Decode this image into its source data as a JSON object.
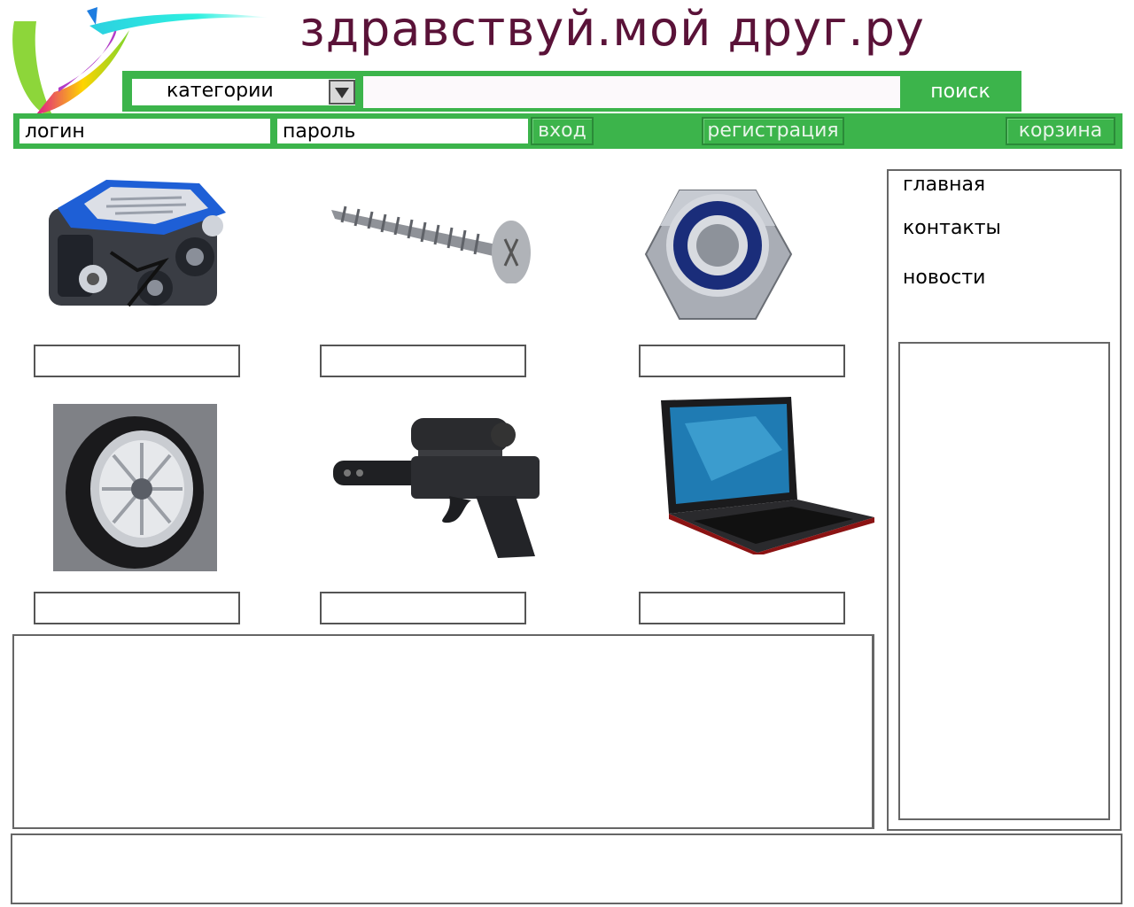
{
  "header": {
    "site_title": "здравствуй.мой друг.ру"
  },
  "search": {
    "category_label": "категории",
    "query": "",
    "button_label": "поиск"
  },
  "auth": {
    "login_placeholder": "логин",
    "password_placeholder": "пароль",
    "login_button": "вход",
    "register_button": "регистрация",
    "cart_button": "корзина"
  },
  "products": [
    {
      "image": "engine-image",
      "caption": ""
    },
    {
      "image": "screw-image",
      "caption": ""
    },
    {
      "image": "nut-image",
      "caption": ""
    },
    {
      "image": "wheel-image",
      "caption": ""
    },
    {
      "image": "pistol-image",
      "caption": ""
    },
    {
      "image": "laptop-image",
      "caption": ""
    }
  ],
  "sidebar": {
    "items": [
      {
        "label": "главная"
      },
      {
        "label": "контакты"
      },
      {
        "label": "новости"
      }
    ]
  },
  "colors": {
    "accent": "#3cb44b",
    "title": "#5a1238"
  }
}
